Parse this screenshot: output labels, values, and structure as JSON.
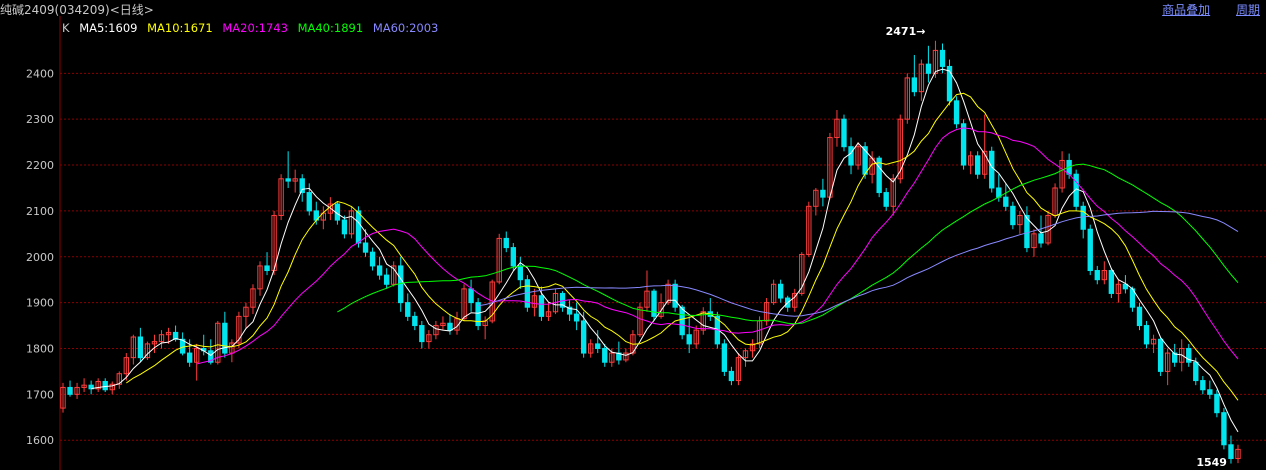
{
  "header": {
    "title": "纯碱2409(034209)<日线>",
    "links": [
      "商品叠加",
      "周期"
    ]
  },
  "legend": {
    "k": "K",
    "ma5": "MA5:1609",
    "ma10": "MA10:1671",
    "ma20": "MA20:1743",
    "ma40": "MA40:1891",
    "ma60": "MA60:2003"
  },
  "colors": {
    "background": "#000000",
    "up": "#ff3c3c",
    "down": "#00e5ee",
    "grid": "#8b0000",
    "axis_text": "#c8c8c8",
    "ma5": "#ffffff",
    "ma10": "#ffff00",
    "ma20": "#ff00ff",
    "ma40": "#00ff00",
    "ma60": "#8888ff"
  },
  "chart_data": {
    "type": "candlestick",
    "ylim": [
      1535,
      2525
    ],
    "yticks": [
      1600,
      1700,
      1800,
      1900,
      2000,
      2100,
      2200,
      2300,
      2400
    ],
    "grid": true,
    "annotations": {
      "high": "2471",
      "low": "1549"
    },
    "candles": [
      [
        1670,
        1725,
        1660,
        1715
      ],
      [
        1715,
        1730,
        1695,
        1700
      ],
      [
        1700,
        1725,
        1690,
        1715
      ],
      [
        1715,
        1735,
        1705,
        1720
      ],
      [
        1720,
        1730,
        1700,
        1712
      ],
      [
        1712,
        1735,
        1705,
        1728
      ],
      [
        1728,
        1735,
        1705,
        1710
      ],
      [
        1710,
        1728,
        1700,
        1722
      ],
      [
        1722,
        1750,
        1712,
        1745
      ],
      [
        1745,
        1790,
        1730,
        1780
      ],
      [
        1780,
        1830,
        1765,
        1825
      ],
      [
        1825,
        1845,
        1770,
        1780
      ],
      [
        1780,
        1815,
        1775,
        1810
      ],
      [
        1810,
        1830,
        1790,
        1815
      ],
      [
        1815,
        1840,
        1800,
        1830
      ],
      [
        1830,
        1845,
        1810,
        1835
      ],
      [
        1835,
        1850,
        1815,
        1820
      ],
      [
        1820,
        1835,
        1785,
        1790
      ],
      [
        1790,
        1820,
        1760,
        1770
      ],
      [
        1770,
        1810,
        1730,
        1800
      ],
      [
        1800,
        1830,
        1785,
        1795
      ],
      [
        1795,
        1820,
        1765,
        1770
      ],
      [
        1770,
        1860,
        1765,
        1855
      ],
      [
        1855,
        1880,
        1780,
        1790
      ],
      [
        1790,
        1820,
        1770,
        1812
      ],
      [
        1812,
        1880,
        1800,
        1870
      ],
      [
        1870,
        1900,
        1845,
        1890
      ],
      [
        1890,
        1940,
        1875,
        1930
      ],
      [
        1930,
        1990,
        1915,
        1980
      ],
      [
        1980,
        2010,
        1960,
        1970
      ],
      [
        1970,
        2100,
        1960,
        2090
      ],
      [
        2090,
        2180,
        2080,
        2170
      ],
      [
        2170,
        2230,
        2150,
        2165
      ],
      [
        2165,
        2190,
        2140,
        2170
      ],
      [
        2170,
        2180,
        2120,
        2140
      ],
      [
        2140,
        2160,
        2090,
        2100
      ],
      [
        2100,
        2120,
        2070,
        2080
      ],
      [
        2080,
        2110,
        2060,
        2095
      ],
      [
        2095,
        2130,
        2080,
        2115
      ],
      [
        2115,
        2120,
        2070,
        2080
      ],
      [
        2080,
        2090,
        2040,
        2050
      ],
      [
        2050,
        2110,
        2040,
        2100
      ],
      [
        2100,
        2110,
        2020,
        2030
      ],
      [
        2030,
        2060,
        2000,
        2010
      ],
      [
        2010,
        2020,
        1970,
        1980
      ],
      [
        1980,
        2000,
        1950,
        1960
      ],
      [
        1960,
        1975,
        1930,
        1940
      ],
      [
        1940,
        1990,
        1935,
        1980
      ],
      [
        1980,
        2000,
        1880,
        1900
      ],
      [
        1900,
        1920,
        1860,
        1870
      ],
      [
        1870,
        1880,
        1840,
        1850
      ],
      [
        1850,
        1860,
        1800,
        1815
      ],
      [
        1815,
        1840,
        1800,
        1830
      ],
      [
        1830,
        1860,
        1820,
        1850
      ],
      [
        1850,
        1870,
        1840,
        1855
      ],
      [
        1855,
        1875,
        1830,
        1840
      ],
      [
        1840,
        1880,
        1830,
        1865
      ],
      [
        1865,
        1940,
        1860,
        1930
      ],
      [
        1930,
        1950,
        1880,
        1900
      ],
      [
        1900,
        1910,
        1840,
        1850
      ],
      [
        1850,
        1870,
        1820,
        1860
      ],
      [
        1860,
        1950,
        1855,
        1945
      ],
      [
        1945,
        2050,
        1940,
        2040
      ],
      [
        2040,
        2055,
        2010,
        2020
      ],
      [
        2020,
        2030,
        1970,
        1980
      ],
      [
        1980,
        2000,
        1930,
        1950
      ],
      [
        1950,
        1960,
        1880,
        1890
      ],
      [
        1890,
        1930,
        1870,
        1915
      ],
      [
        1915,
        1935,
        1860,
        1870
      ],
      [
        1870,
        1900,
        1860,
        1880
      ],
      [
        1880,
        1930,
        1875,
        1920
      ],
      [
        1920,
        1925,
        1880,
        1890
      ],
      [
        1890,
        1905,
        1860,
        1875
      ],
      [
        1875,
        1900,
        1840,
        1860
      ],
      [
        1860,
        1880,
        1780,
        1790
      ],
      [
        1790,
        1820,
        1780,
        1810
      ],
      [
        1810,
        1840,
        1790,
        1800
      ],
      [
        1800,
        1810,
        1760,
        1770
      ],
      [
        1770,
        1800,
        1760,
        1790
      ],
      [
        1790,
        1815,
        1765,
        1775
      ],
      [
        1775,
        1800,
        1770,
        1790
      ],
      [
        1790,
        1840,
        1785,
        1830
      ],
      [
        1830,
        1900,
        1825,
        1890
      ],
      [
        1890,
        1970,
        1880,
        1925
      ],
      [
        1925,
        1930,
        1860,
        1870
      ],
      [
        1870,
        1920,
        1865,
        1900
      ],
      [
        1900,
        1950,
        1895,
        1940
      ],
      [
        1940,
        1950,
        1880,
        1890
      ],
      [
        1890,
        1895,
        1820,
        1830
      ],
      [
        1830,
        1870,
        1790,
        1810
      ],
      [
        1810,
        1850,
        1800,
        1840
      ],
      [
        1840,
        1890,
        1830,
        1880
      ],
      [
        1880,
        1910,
        1860,
        1870
      ],
      [
        1870,
        1880,
        1800,
        1810
      ],
      [
        1810,
        1820,
        1740,
        1750
      ],
      [
        1750,
        1760,
        1720,
        1730
      ],
      [
        1730,
        1790,
        1720,
        1780
      ],
      [
        1780,
        1800,
        1760,
        1795
      ],
      [
        1795,
        1820,
        1780,
        1810
      ],
      [
        1810,
        1870,
        1800,
        1860
      ],
      [
        1860,
        1910,
        1850,
        1900
      ],
      [
        1900,
        1950,
        1895,
        1940
      ],
      [
        1940,
        1950,
        1900,
        1910
      ],
      [
        1910,
        1915,
        1880,
        1890
      ],
      [
        1890,
        1930,
        1880,
        1920
      ],
      [
        1920,
        2010,
        1915,
        2005
      ],
      [
        2005,
        2120,
        2000,
        2110
      ],
      [
        2110,
        2150,
        2090,
        2145
      ],
      [
        2145,
        2170,
        2110,
        2130
      ],
      [
        2130,
        2270,
        2125,
        2260
      ],
      [
        2260,
        2320,
        2240,
        2300
      ],
      [
        2300,
        2310,
        2230,
        2240
      ],
      [
        2240,
        2260,
        2180,
        2200
      ],
      [
        2200,
        2250,
        2190,
        2240
      ],
      [
        2240,
        2250,
        2170,
        2180
      ],
      [
        2180,
        2230,
        2160,
        2215
      ],
      [
        2215,
        2220,
        2130,
        2140
      ],
      [
        2140,
        2150,
        2100,
        2110
      ],
      [
        2110,
        2180,
        2090,
        2170
      ],
      [
        2170,
        2310,
        2160,
        2300
      ],
      [
        2300,
        2400,
        2290,
        2390
      ],
      [
        2390,
        2440,
        2350,
        2360
      ],
      [
        2360,
        2430,
        2340,
        2420
      ],
      [
        2420,
        2460,
        2380,
        2400
      ],
      [
        2400,
        2471,
        2390,
        2450
      ],
      [
        2450,
        2465,
        2400,
        2415
      ],
      [
        2415,
        2430,
        2330,
        2340
      ],
      [
        2340,
        2350,
        2280,
        2290
      ],
      [
        2290,
        2300,
        2190,
        2200
      ],
      [
        2200,
        2230,
        2180,
        2220
      ],
      [
        2220,
        2230,
        2170,
        2180
      ],
      [
        2180,
        2310,
        2170,
        2230
      ],
      [
        2230,
        2240,
        2140,
        2150
      ],
      [
        2150,
        2180,
        2120,
        2130
      ],
      [
        2130,
        2160,
        2100,
        2110
      ],
      [
        2110,
        2120,
        2060,
        2070
      ],
      [
        2070,
        2100,
        2050,
        2090
      ],
      [
        2090,
        2110,
        2010,
        2020
      ],
      [
        2020,
        2060,
        2000,
        2050
      ],
      [
        2050,
        2090,
        2020,
        2030
      ],
      [
        2030,
        2100,
        2025,
        2090
      ],
      [
        2090,
        2160,
        2085,
        2150
      ],
      [
        2150,
        2230,
        2140,
        2210
      ],
      [
        2210,
        2225,
        2170,
        2180
      ],
      [
        2180,
        2190,
        2100,
        2110
      ],
      [
        2110,
        2120,
        2040,
        2060
      ],
      [
        2060,
        2070,
        1960,
        1970
      ],
      [
        1970,
        1980,
        1940,
        1950
      ],
      [
        1950,
        1990,
        1940,
        1970
      ],
      [
        1970,
        1975,
        1910,
        1920
      ],
      [
        1920,
        1950,
        1900,
        1940
      ],
      [
        1940,
        1960,
        1920,
        1930
      ],
      [
        1930,
        1935,
        1880,
        1890
      ],
      [
        1890,
        1900,
        1840,
        1850
      ],
      [
        1850,
        1860,
        1800,
        1810
      ],
      [
        1810,
        1830,
        1790,
        1820
      ],
      [
        1820,
        1825,
        1740,
        1750
      ],
      [
        1750,
        1800,
        1720,
        1790
      ],
      [
        1790,
        1810,
        1760,
        1770
      ],
      [
        1770,
        1820,
        1750,
        1800
      ],
      [
        1800,
        1810,
        1760,
        1770
      ],
      [
        1770,
        1780,
        1720,
        1730
      ],
      [
        1730,
        1740,
        1700,
        1710
      ],
      [
        1710,
        1730,
        1690,
        1700
      ],
      [
        1700,
        1710,
        1650,
        1660
      ],
      [
        1660,
        1670,
        1580,
        1590
      ],
      [
        1590,
        1610,
        1549,
        1560
      ],
      [
        1560,
        1590,
        1550,
        1580
      ]
    ]
  }
}
